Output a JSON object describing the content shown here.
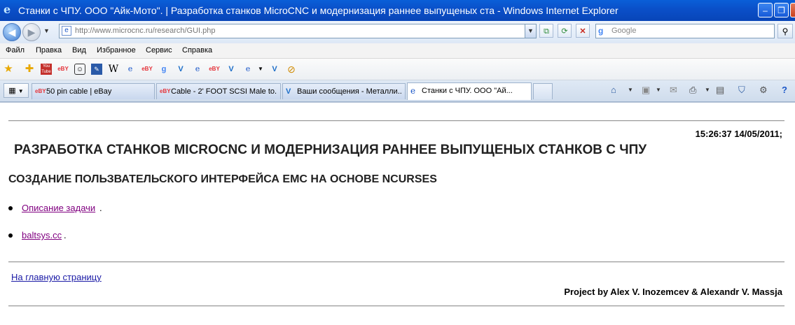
{
  "window": {
    "title": "Станки с ЧПУ. ООО \"Айк-Мото\". | Разработка станков MicroCNC и модернизация раннее выпущеных ста - Windows Internet Explorer",
    "minimize": "–",
    "maximize": "❐",
    "close": "✕"
  },
  "address_bar": {
    "url": "http://www.microcnc.ru/research/GUI.php",
    "search_placeholder": "Google"
  },
  "menu": [
    "Файл",
    "Правка",
    "Вид",
    "Избранное",
    "Сервис",
    "Справка"
  ],
  "links_toolbar": [
    "favorites-star-icon",
    "add-favorites-icon",
    "youtube-icon",
    "ebay-icon",
    "face-icon",
    "edit-icon",
    "wikipedia-icon",
    "ie-page-icon",
    "ebay-icon",
    "google-icon",
    "metal-v-icon",
    "ie-page-icon",
    "ebay-icon",
    "ie-page-icon",
    "metal-v-icon",
    "compass-icon"
  ],
  "tabs": [
    {
      "label": "50 pin cable | eBay",
      "icon": "ebay-icon",
      "active": false
    },
    {
      "label": "Cable - 2' FOOT SCSI Male to...",
      "icon": "ebay-icon",
      "active": false
    },
    {
      "label": "Ваши сообщения - Металли...",
      "icon": "metal-v-icon",
      "active": false
    },
    {
      "label": "Станки с ЧПУ. ООО \"Ай...",
      "icon": "ie-page-icon",
      "active": true
    }
  ],
  "page": {
    "datetime": "15:26:37 14/05/2011;",
    "heading": "РАЗРАБОТКА СТАНКОВ MICROCNC И МОДЕРНИЗАЦИЯ РАННЕЕ ВЫПУЩЕНЫХ СТАНКОВ С ЧПУ",
    "subheading": "СОЗДАНИЕ ПОЛЬЗВАТЕЛЬСКОГО ИНТЕРФЕЙСА EMC НА ОСНОВЕ NCURSES",
    "links": [
      {
        "text": "Описание задачи",
        "suffix": "."
      },
      {
        "text": "baltsys.cc",
        "suffix": "."
      }
    ],
    "home_link": "На главную страницу",
    "credit": "Project by Alex V. Inozemcev & Alexandr V. Massja"
  },
  "colors": {
    "titlebar": "#0a4fc8",
    "visited_link": "#800080",
    "link": "#1a1aa6"
  }
}
